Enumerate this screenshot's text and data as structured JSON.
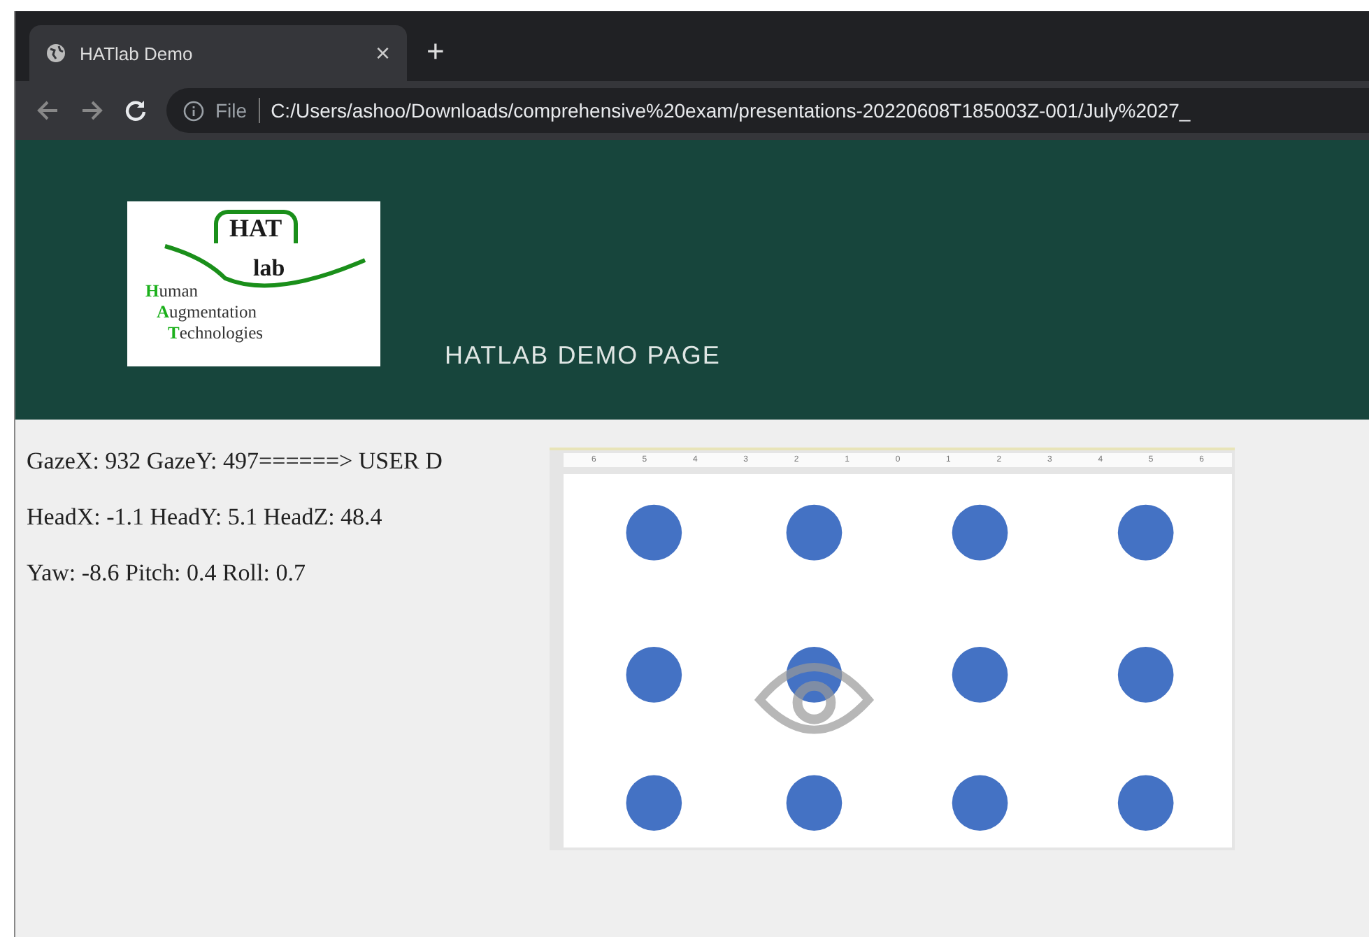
{
  "browser": {
    "tab": {
      "title": "HATlab Demo",
      "close": "×"
    },
    "new_tab": "+",
    "address": {
      "scheme_label": "File",
      "url": "C:/Users/ashoo/Downloads/comprehensive%20exam/presentations-20220608T185003Z-001/July%2027_"
    }
  },
  "header": {
    "logo": {
      "top": "HAT",
      "middle": "lab",
      "lines": [
        {
          "initial": "H",
          "rest": "uman"
        },
        {
          "initial": "A",
          "rest": "ugmentation"
        },
        {
          "initial": "T",
          "rest": "echnologies"
        }
      ]
    },
    "title": "HATLAB DEMO PAGE"
  },
  "readings": [
    "GazeX: 932 GazeY: 497======> USER D",
    "HeadX: -1.1 HeadY: 5.1 HeadZ: 48.4",
    "Yaw: -8.6 Pitch: 0.4 Roll: 0.7"
  ],
  "ruler_labels": [
    "6",
    "5",
    "4",
    "3",
    "2",
    "1",
    "0",
    "1",
    "2",
    "3",
    "4",
    "5",
    "6"
  ]
}
